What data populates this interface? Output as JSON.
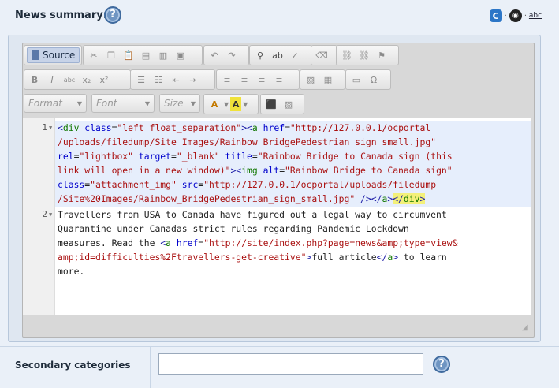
{
  "field": {
    "label": "News summary:",
    "help_glyph": "?"
  },
  "right_icons": {
    "c_label": "C",
    "dot": "·",
    "eye_label": "◉",
    "abc_label": "abc"
  },
  "toolbar": {
    "source_label": "Source",
    "format_label": "Format",
    "font_label": "Font",
    "size_label": "Size",
    "text_color_label": "A",
    "bg_color_label": "A"
  },
  "code": {
    "line_numbers": [
      "1",
      "2"
    ]
  },
  "secondary": {
    "label": "Secondary categories",
    "input_value": "",
    "help_glyph": "?"
  },
  "colors": {
    "page_bg": "#eaf0f8",
    "help_blue": "#6f95c2",
    "source_active": "#c7d3e8"
  }
}
